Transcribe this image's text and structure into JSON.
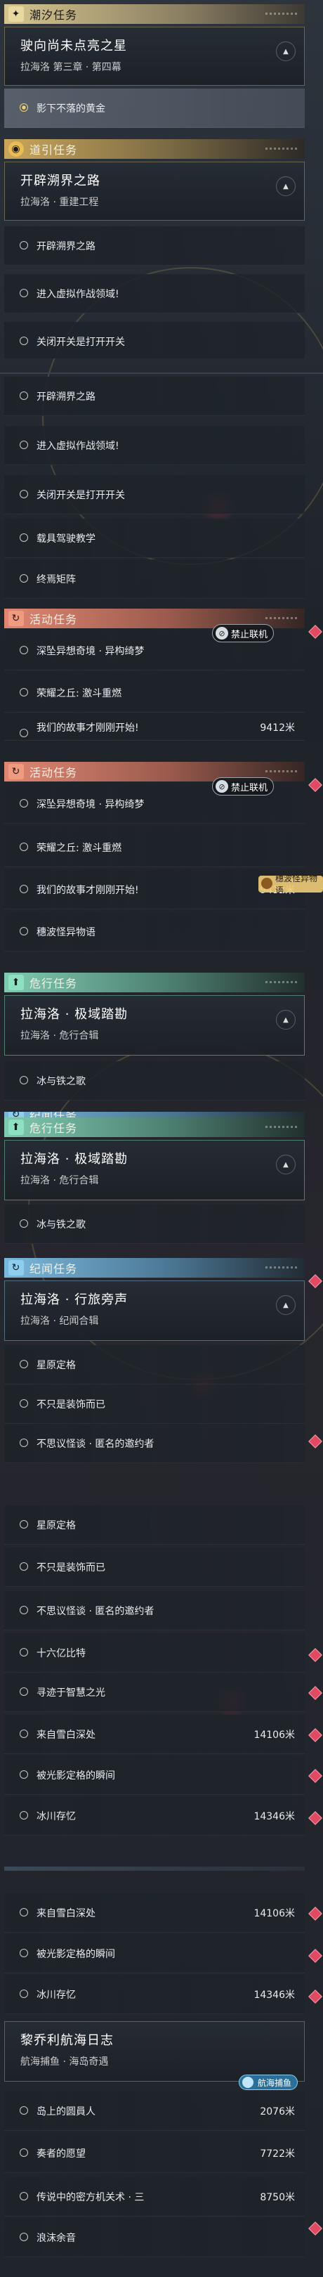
{
  "sections": {
    "tide": "潮汐任务",
    "guide": "道引任务",
    "event": "活动任务",
    "danger": "危行任务",
    "chronicle": "纪闻任务"
  },
  "quests": {
    "tide_main": {
      "title": "驶向尚未点亮之星",
      "sub": "拉海洛 第三章 · 第四幕",
      "step": "影下不落的黄金"
    },
    "guide_main": {
      "title": "开辟溯界之路",
      "sub": "拉海洛 · 重建工程"
    },
    "guide_steps": [
      "开辟溯界之路",
      "进入虚拟作战领域!",
      "关闭开关是打开开关",
      "载具驾驶教学",
      "终焉矩阵"
    ],
    "event_steps": [
      "深坠异想奇境 · 异构绮梦",
      "荣耀之丘: 激斗重燃",
      "我们的故事才刚刚开始!",
      "穗波怪异物语"
    ],
    "event_dist": "9412米",
    "danger_main": {
      "title": "拉海洛 · 极域踏勘",
      "sub": "拉海洛 · 危行合辑",
      "step": "冰与铁之歌"
    },
    "chron_main": {
      "title": "拉海洛 · 行旅旁声",
      "sub": "拉海洛 · 纪闻合辑"
    },
    "chron_steps": [
      "星原定格",
      "不只是装饰而已",
      "不思议怪谈 · 匿名的邀约者",
      "十六亿比特",
      "寻迹于智慧之光",
      "来自雪白深处",
      "被光影定格的瞬间",
      "冰川存忆"
    ],
    "chron_dist_snow": "14106米",
    "chron_dist_ice": "14346米",
    "voyage_main": {
      "title": "黎乔利航海日志",
      "sub": "航海捕鱼 · 海岛奇遇"
    },
    "voyage_steps": [
      "岛上的圆員人",
      "奏者的愿望",
      "传说中的密方机关术 · 三",
      "浪沫余音"
    ],
    "voyage_dist": [
      "2076米",
      "7722米",
      "8750米"
    ]
  },
  "badges": {
    "forbidden": "禁止联机",
    "story": "穗波怪异物语",
    "voyage": "航海捕鱼"
  },
  "colors": {
    "accent_gold": "#d6c58e",
    "event": "#e08772",
    "danger": "#7fcab0",
    "chronicle": "#7bb8dd",
    "marker": "#e04a63"
  }
}
